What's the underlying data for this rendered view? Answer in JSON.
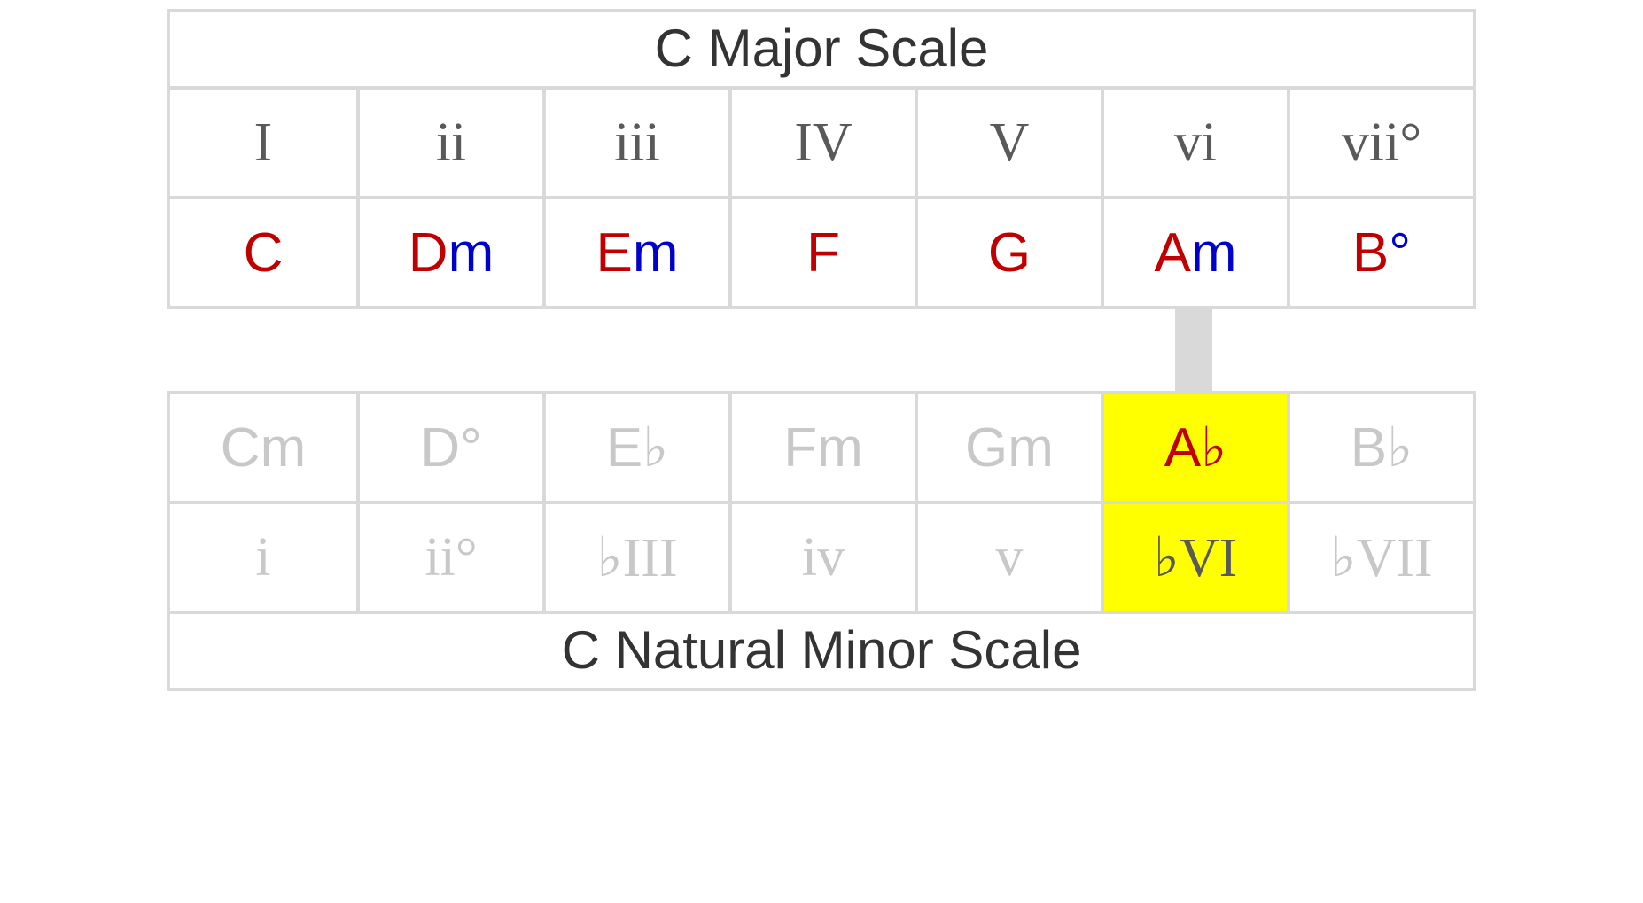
{
  "major": {
    "title": "C Major Scale",
    "romans": [
      "I",
      "ii",
      "iii",
      "IV",
      "V",
      "vi",
      "vii°"
    ],
    "chords": [
      {
        "root": "C",
        "qual": ""
      },
      {
        "root": "D",
        "qual": "m"
      },
      {
        "root": "E",
        "qual": "m"
      },
      {
        "root": "F",
        "qual": ""
      },
      {
        "root": "G",
        "qual": ""
      },
      {
        "root": "A",
        "qual": "m"
      },
      {
        "root": "B",
        "qual": "°"
      }
    ]
  },
  "minor": {
    "title": "C Natural Minor Scale",
    "romans": [
      "i",
      "ii°",
      "♭III",
      "iv",
      "v",
      "♭VI",
      "♭VII"
    ],
    "chords": [
      {
        "root": "C",
        "qual": "m",
        "flat": ""
      },
      {
        "root": "D",
        "qual": "°",
        "flat": ""
      },
      {
        "root": "E",
        "qual": "",
        "flat": "♭"
      },
      {
        "root": "F",
        "qual": "m",
        "flat": ""
      },
      {
        "root": "G",
        "qual": "m",
        "flat": ""
      },
      {
        "root": "A",
        "qual": "",
        "flat": "♭"
      },
      {
        "root": "B",
        "qual": "",
        "flat": "♭"
      }
    ]
  },
  "highlight_index": 5
}
